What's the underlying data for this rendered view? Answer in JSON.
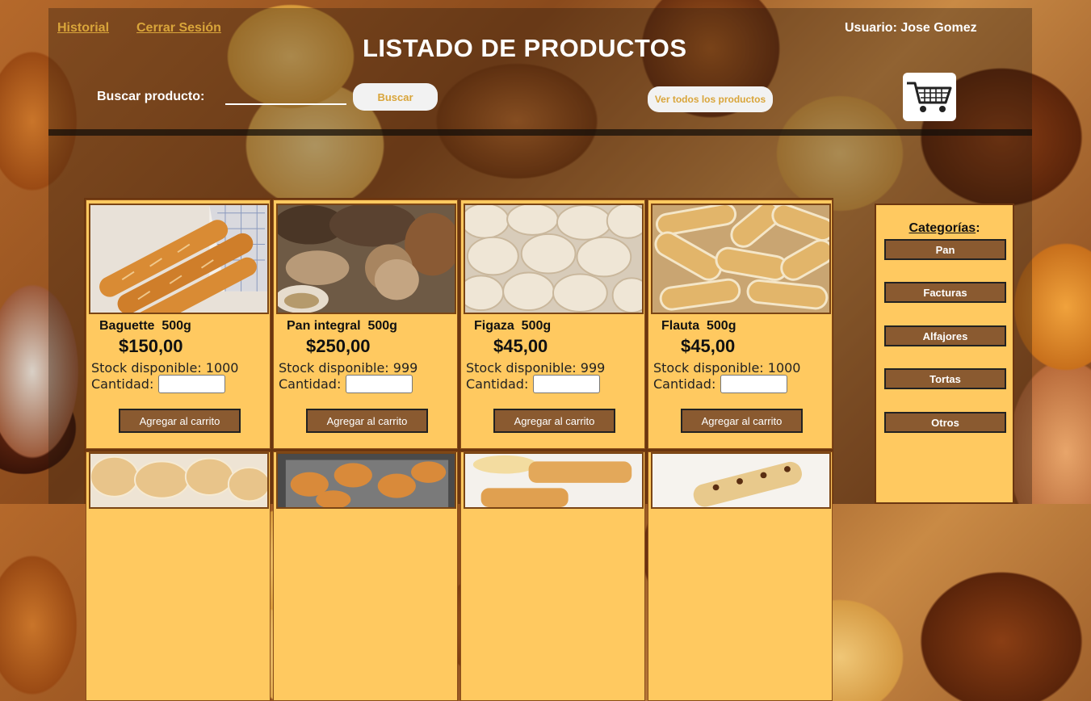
{
  "header": {
    "links": [
      "Historial",
      "Cerrar Sesión"
    ],
    "title": "LISTADO DE PRODUCTOS",
    "user": "Usuario: Jose Gomez",
    "search_label": "Buscar producto:",
    "search_value": "",
    "search_button": "Buscar",
    "view_all_button": "Ver todos los productos",
    "cart_icon": "shopping-cart-icon"
  },
  "products": [
    {
      "name": "Baguette  500g",
      "price": "$150,00",
      "stock": "Stock disponible: 1000",
      "qty_label": "Cantidad:",
      "button": "Agregar al carrito"
    },
    {
      "name": "Pan integral  500g",
      "price": "$250,00",
      "stock": "Stock disponible: 999",
      "qty_label": "Cantidad:",
      "button": "Agregar al carrito"
    },
    {
      "name": "Figaza  500g",
      "price": "$45,00",
      "stock": "Stock disponible: 999",
      "qty_label": "Cantidad:",
      "button": "Agregar al carrito"
    },
    {
      "name": "Flauta  500g",
      "price": "$45,00",
      "stock": "Stock disponible: 1000",
      "qty_label": "Cantidad:",
      "button": "Agregar al carrito"
    }
  ],
  "sidebar": {
    "title": "Categorías",
    "title_suffix": ":",
    "categories": [
      "Pan",
      "Facturas",
      "Alfajores",
      "Tortas",
      "Otros"
    ]
  },
  "colors": {
    "accent": "#d9a53a",
    "card_bg": "#ffc960",
    "button_bg": "#8a5a30",
    "border_dark": "#6b3610"
  }
}
